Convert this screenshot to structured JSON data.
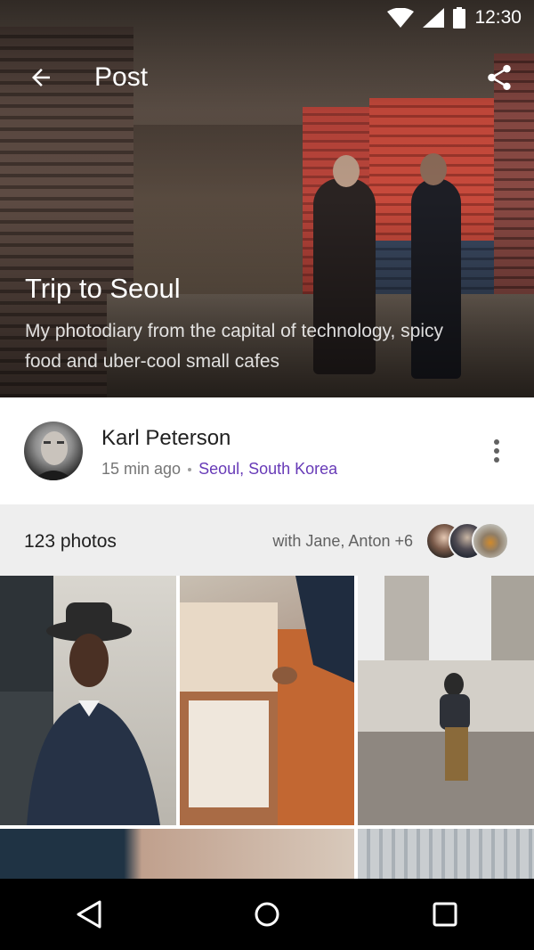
{
  "status_bar": {
    "time": "12:30"
  },
  "toolbar": {
    "title": "Post"
  },
  "post": {
    "title": "Trip to Seoul",
    "subtitle": "My photodiary from the capital of technology, spicy food and uber-cool small cafes"
  },
  "author": {
    "name": "Karl Peterson",
    "time_ago": "15 min ago",
    "location": "Seoul, South Korea"
  },
  "photos": {
    "count_label": "123 photos",
    "with_label": "with Jane, Anton +6"
  },
  "colors": {
    "accent": "#673ab7",
    "bar_background": "#eeeeee"
  }
}
